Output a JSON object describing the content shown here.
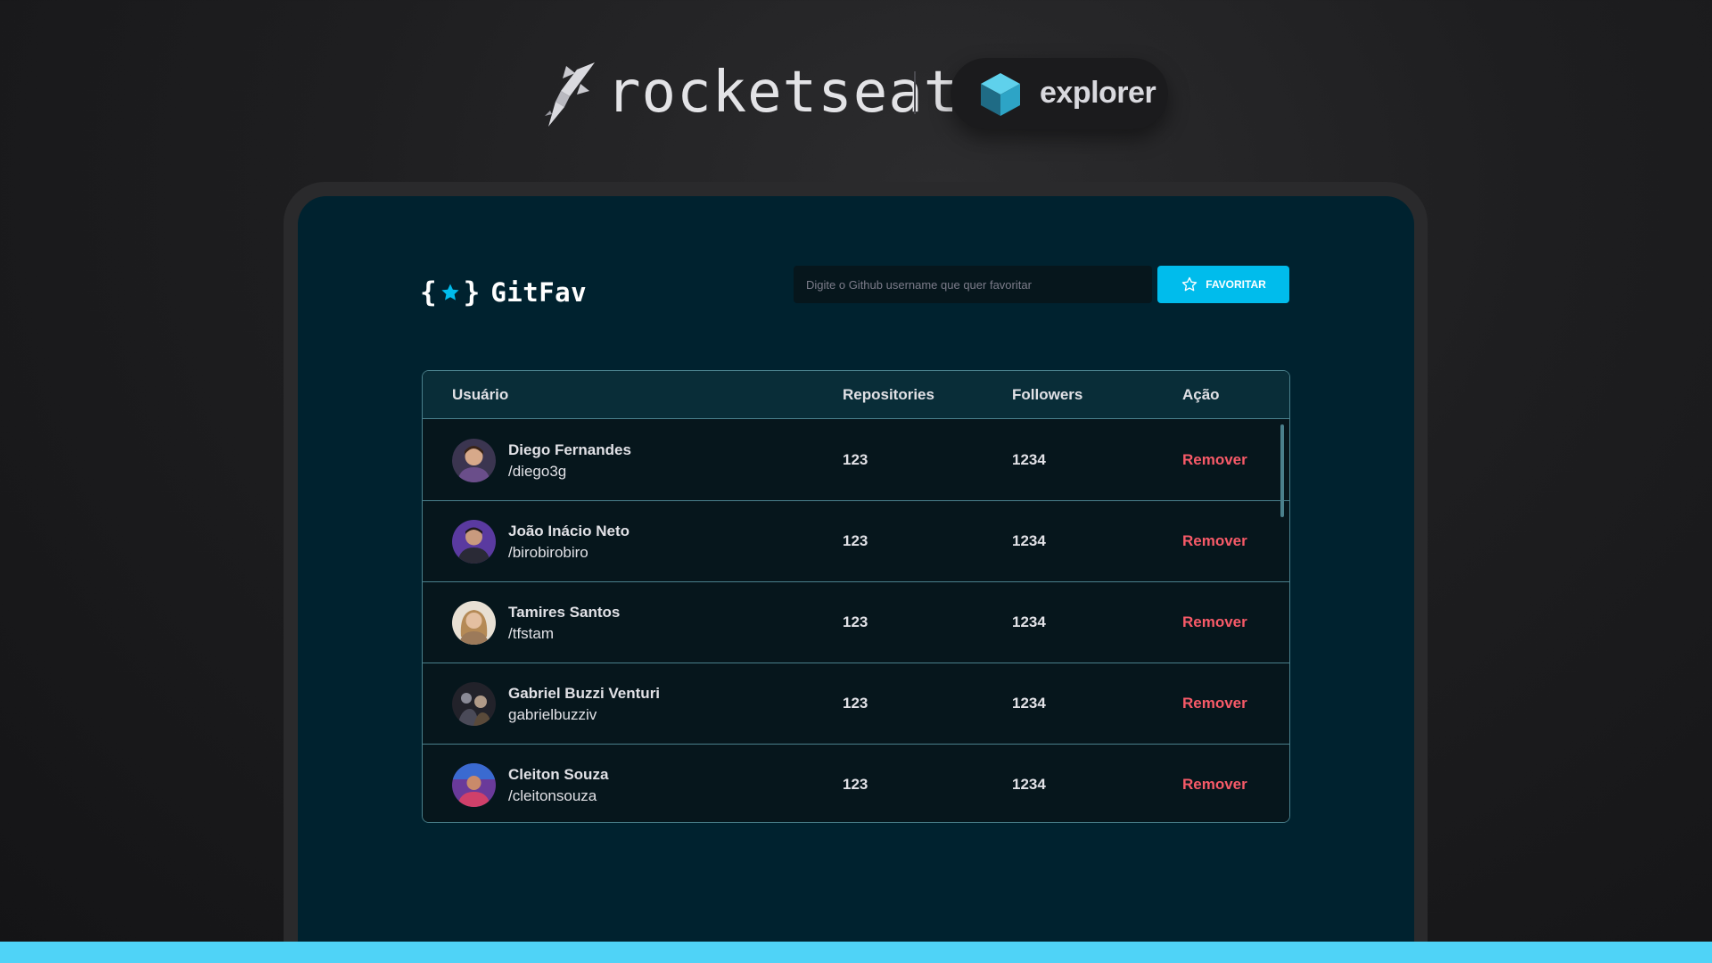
{
  "brand": {
    "name": "rocketseat",
    "product": "explorer"
  },
  "app": {
    "title": "GitFav",
    "search": {
      "placeholder": "Digite o Github username que quer favoritar",
      "value": ""
    },
    "favorite_button": "FAVORITAR"
  },
  "colors": {
    "accent": "#00bcec",
    "remove": "#f75a68",
    "screen_bg": "#00222f",
    "row_bg": "#06161c",
    "border": "#4a808c",
    "bottom_bar": "#4fd3f7"
  },
  "table": {
    "headers": {
      "user": "Usuário",
      "repositories": "Repositories",
      "followers": "Followers",
      "action": "Ação"
    },
    "rows": [
      {
        "name": "Diego Fernandes",
        "login": "/diego3g",
        "repositories": "123",
        "followers": "1234",
        "action": "Remover",
        "avatar_color": "#8a5a44"
      },
      {
        "name": "João Inácio Neto",
        "login": "/birobirobiro",
        "repositories": "123",
        "followers": "1234",
        "action": "Remover",
        "avatar_color": "#5a3aa0"
      },
      {
        "name": "Tamires Santos",
        "login": "/tfstam",
        "repositories": "123",
        "followers": "1234",
        "action": "Remover",
        "avatar_color": "#c8a07a"
      },
      {
        "name": "Gabriel Buzzi Venturi",
        "login": "gabrielbuzziv",
        "repositories": "123",
        "followers": "1234",
        "action": "Remover",
        "avatar_color": "#3a3a44"
      },
      {
        "name": "Cleiton Souza",
        "login": "/cleitonsouza",
        "repositories": "123",
        "followers": "1234",
        "action": "Remover",
        "avatar_color": "#8a3a8a"
      }
    ]
  }
}
